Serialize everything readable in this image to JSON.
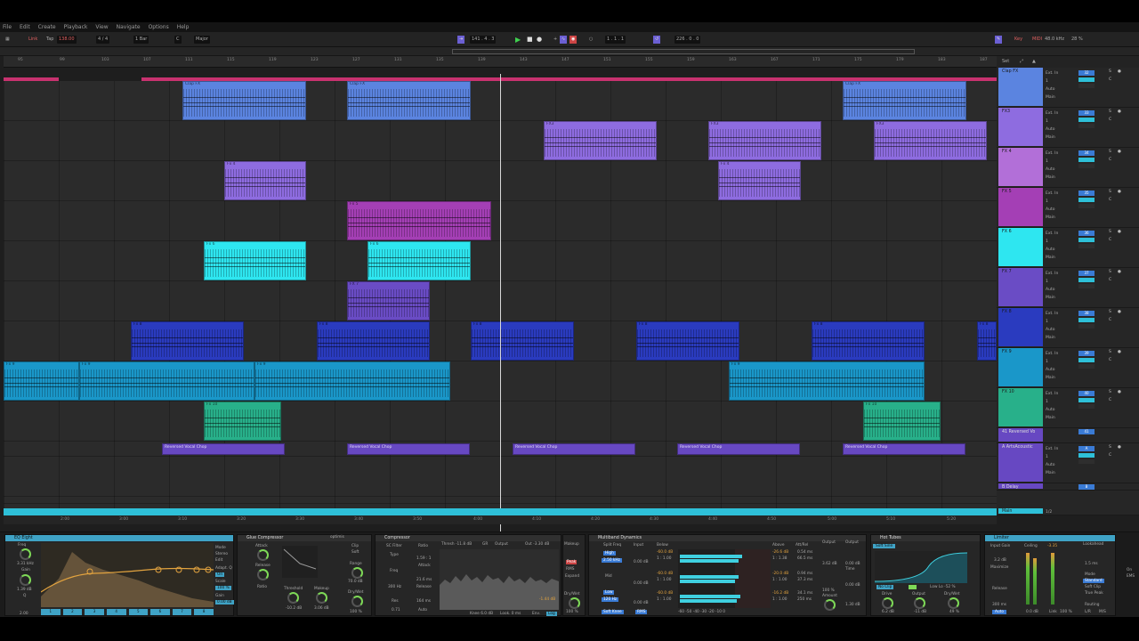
{
  "menu": [
    "File",
    "Edit",
    "Create",
    "Playback",
    "View",
    "Navigate",
    "Options",
    "Help"
  ],
  "transport": {
    "link": "Link",
    "tap": "Tap",
    "tempo": "138.00",
    "signature": "4 / 4",
    "bar": "1 Bar",
    "key": "C",
    "scale": "Major",
    "position": "141 . 4 . 3",
    "loop_start": "1 . 1 . 1",
    "loop_length": "226 . 0 . 0",
    "key_label": "Key",
    "midi_label": "MIDI",
    "rate": "48.0 kHz",
    "cpu": "28 %"
  },
  "ruler_ticks": [
    "95",
    "99",
    "103",
    "107",
    "111",
    "115",
    "119",
    "123",
    "127",
    "131",
    "135",
    "139",
    "143",
    "147",
    "151",
    "155",
    "159",
    "163",
    "167",
    "171",
    "175",
    "179",
    "183",
    "187"
  ],
  "time_ticks": [
    "2:00",
    "3:00",
    "3:10",
    "3:20",
    "3:30",
    "3:40",
    "3:50",
    "4:00",
    "4:10",
    "4:20",
    "4:30",
    "4:40",
    "4:50",
    "5:00",
    "5:10",
    "5:20"
  ],
  "set_label": "Set",
  "clips": {
    "clap_fx": "Clap FX",
    "fx3": "FX3",
    "fx4": "Fx 4",
    "fx5": "Fx 5",
    "fx6": "Fx 6",
    "fx7": "FX 7",
    "fx8": "Fx 8",
    "fx9": "Fx 9",
    "fx10": "Fx 10",
    "rvc": "Reversed Vocal Chop"
  },
  "tracks": [
    {
      "name": "Clap FX",
      "num": "32",
      "color": "#5b84e0"
    },
    {
      "name": "FX3",
      "num": "33",
      "color": "#8e6ce0"
    },
    {
      "name": "FX 4",
      "num": "34",
      "color": "#b26fd8"
    },
    {
      "name": "FX 5",
      "num": "35",
      "color": "#a43fb5"
    },
    {
      "name": "FX 6",
      "num": "36",
      "color": "#2ee6f0"
    },
    {
      "name": "FX 7",
      "num": "37",
      "color": "#6a4cc5"
    },
    {
      "name": "FX 8",
      "num": "38",
      "color": "#2a3bbf"
    },
    {
      "name": "FX 9",
      "num": "39",
      "color": "#1a97c9"
    },
    {
      "name": "FX 10",
      "num": "40",
      "color": "#28b08a"
    },
    {
      "name": "41 Reversed Vo",
      "num": "41",
      "color": "#6748c2"
    },
    {
      "name": "A ArtsAcoustic",
      "num": "A",
      "color": "#6748c2"
    },
    {
      "name": "B Delay",
      "num": "B",
      "color": "#6748c2"
    }
  ],
  "track_io": {
    "ext": "Ext. In",
    "in": "In",
    "auto": "Auto",
    "off": "Off",
    "main": "Main",
    "chan": "1"
  },
  "master": {
    "name": "Main",
    "value": "1/2"
  },
  "devices": {
    "eq": "EQ Eight",
    "eq_freq": "3.31 kHz",
    "eq_gain": "1.39 dB",
    "eq_q": "2.00",
    "eq_mode": "Mode",
    "eq_stereo": "Stereo",
    "eq_edit": "Edit",
    "eq_adapt": "Adapt. Q",
    "eq_on": "On",
    "eq_scale": "Scale",
    "eq_scale_val": "100 %",
    "eq_gain_label": "Gain",
    "eq_gain_val": "0.00 dB",
    "glue": "Glue Compressor",
    "glue_attack": "Attack",
    "glue_release": "Release",
    "glue_ratio": "Ratio",
    "glue_threshold": "Threshold",
    "glue_thr_val": "-10.2 dB",
    "glue_makeup": "Makeup",
    "glue_mk_val": "3.06 dB",
    "glue_clip": "Clip",
    "glue_soft": "Soft",
    "glue_range": "Range",
    "glue_range_val": "70.0 dB",
    "glue_drywet": "Dry/Wet",
    "glue_dw_val": "100 %",
    "glue_opt": "optimis",
    "comp": "Compressor",
    "comp_sc": "SC Filter",
    "comp_type": "Type",
    "comp_freq": "Freq",
    "comp_freq_val": "300 Hz",
    "comp_res": "Res",
    "comp_res_val": "0.71",
    "comp_ratio": "Ratio",
    "comp_ratio_val": "1.59 : 1",
    "comp_attack": "Attack",
    "comp_att_val": "21.6 ms",
    "comp_release": "Release",
    "comp_rel_val": "164 ms",
    "comp_auto": "Auto",
    "comp_thresh": "Thresh -11.8 dB",
    "comp_gr": "GR",
    "comp_output": "Output",
    "comp_out": "Out -3.30 dB",
    "comp_knee": "Knee 6.0 dB",
    "comp_look": "Look. 0 ms",
    "comp_env": "Env.",
    "comp_log": "Log",
    "comp_makeup": "Makeup",
    "comp_peak": "Peak",
    "comp_rms": "RMS",
    "comp_expand": "Expand",
    "comp_drywet": "Dry/Wet",
    "comp_dw_val": "100 %",
    "comp_gain_val": "-1.44 dB",
    "mbd": "Multiband Dynamics",
    "mbd_split": "Split Freq",
    "mbd_input": "Input",
    "mbd_below": "Below",
    "mbd_above": "Above",
    "mbd_attrel": "Att/Rel",
    "mbd_output": "Output",
    "mbd_high": "High",
    "mbd_mid": "Mid",
    "mbd_low": "Low",
    "mbd_high_freq": "2.50 kHz",
    "mbd_low_freq": "120 Hz",
    "mbd_soft": "Soft Knee",
    "mbd_rms": "RMS",
    "mbd_b1": "-60.0 dB",
    "mbd_r1": "1 : 1.00",
    "mbd_a1": "-26.6 dB",
    "mbd_ar1": "0.54 ms",
    "mbd_o1": "0.00 dB",
    "mbd_b2": "-60.0 dB",
    "mbd_r2": "1 : 1.00",
    "mbd_a2": "-20.0 dB",
    "mbd_ar2": "0.94 ms",
    "mbd_o2": "0.00 dB",
    "mbd_b3": "-60.0 dB",
    "mbd_r3": "1 : 1.00",
    "mbd_a3": "-16.2 dB",
    "mbd_ar3": "34.1 ms",
    "mbd_o3": "0.00 dB",
    "mbd_ratio1": "1 : 1.38",
    "mbd_ratio2": "1 : 1.00",
    "mbd_ratio3": "1 : 1.00",
    "mbd_ms1": "66.5 ms",
    "mbd_ms2": "37.3 ms",
    "mbd_ms3": "250 ms",
    "mbd_out_val": "3.62 dB",
    "mbd_amount": "Amount",
    "mbd_amount_val": "100 %",
    "mbd_time": "Time",
    "mbd_time_val": "100 %",
    "mbd_out2": "1.30 dB",
    "scale_ticks": "-60 -50 -40 -30 -20 -10 0",
    "hot": "Hot Tubes",
    "hot_soft": "Soft Sine",
    "hot_noclip": "No Clip",
    "hot_lowlo": "Low Lo -52 %",
    "hot_drive": "Drive",
    "hot_drive_val": "6.2 dB",
    "hot_output": "Output",
    "hot_out_val": "-11 dB",
    "hot_drywet": "Dry/Wet",
    "hot_dw_val": "49 %",
    "lim": "Limiter",
    "lim_input": "Input Gain",
    "lim_input_val": "3.2 dB",
    "lim_maximize": "Maximize",
    "lim_ceiling": "Ceiling",
    "lim_ceil_val": "-3.35",
    "lim_lookahead": "Lookahead",
    "lim_look_val": "1.5 ms",
    "lim_release": "Release",
    "lim_rel_val": "300 ms",
    "lim_auto": "Auto",
    "lim_mode": "Mode",
    "lim_standard": "Standard",
    "lim_softclip": "Soft Clip",
    "lim_truepeak": "True Peak",
    "lim_routing": "Routing",
    "lim_lr": "L/R",
    "lim_ms": "M/S",
    "lim_gr_val": "0.0 dB",
    "lim_link": "Link",
    "lim_link_val": "100 %",
    "lim_on": "On",
    "lim_ems": "EMS"
  }
}
